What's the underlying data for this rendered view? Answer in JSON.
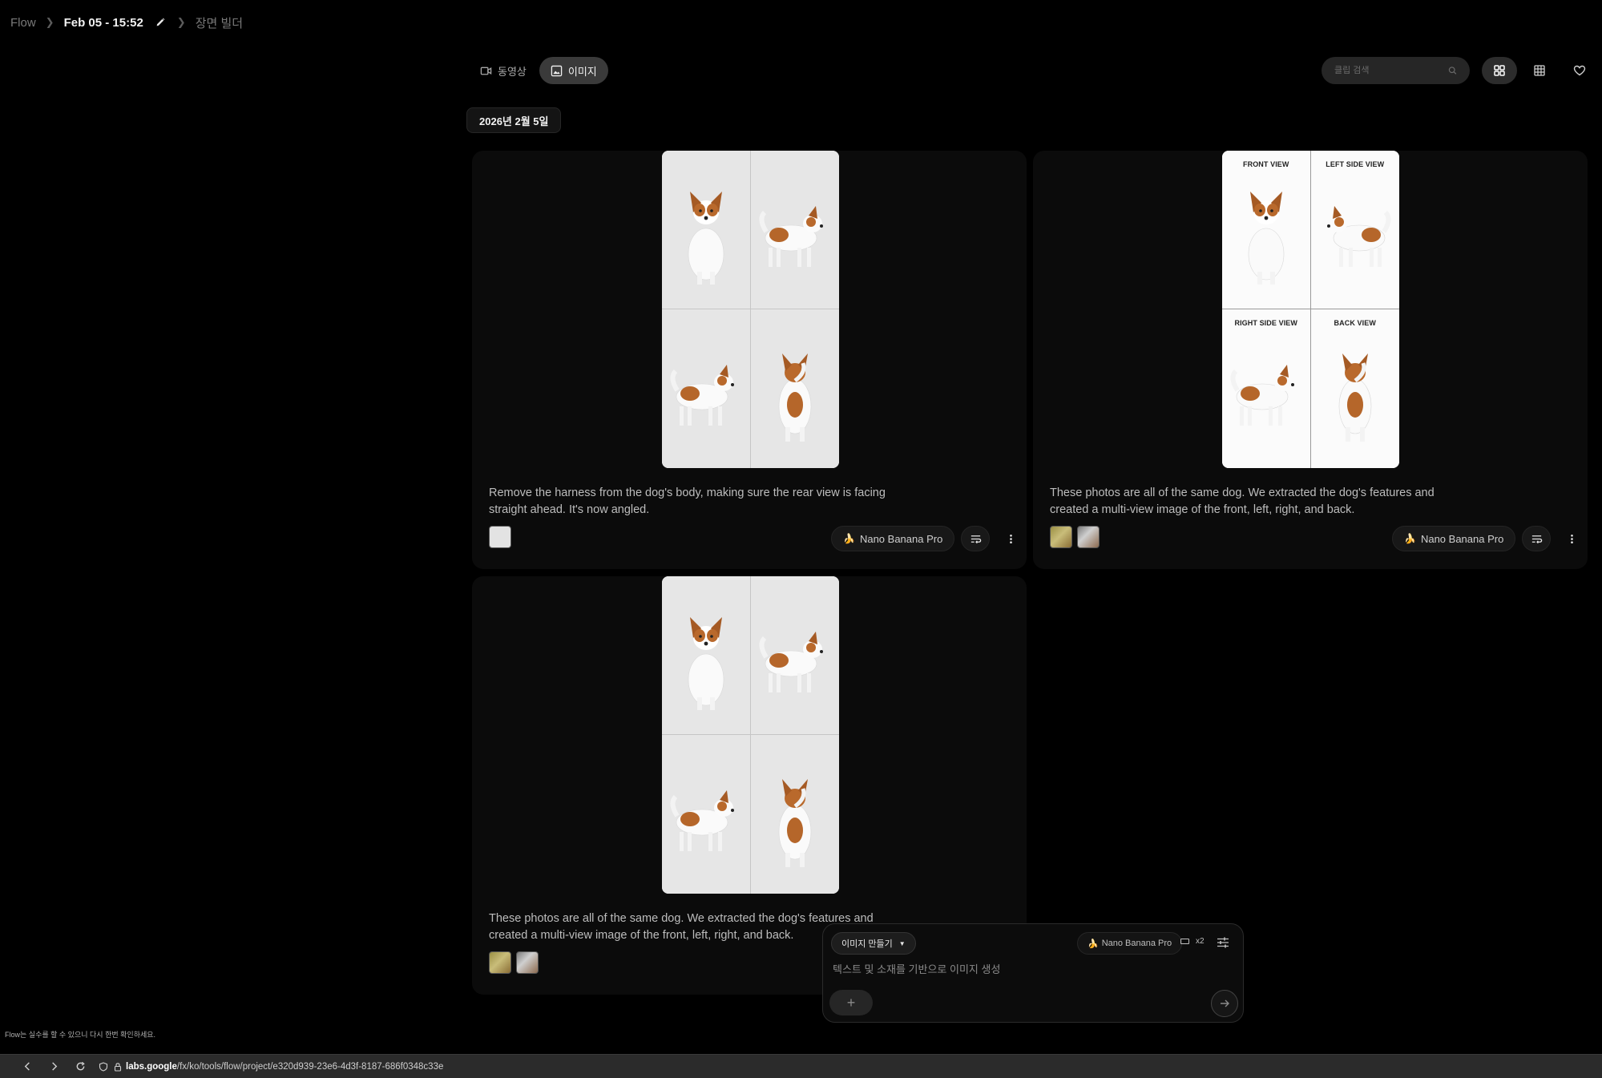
{
  "breadcrumb": {
    "root": "Flow",
    "project": "Feb 05 - 15:52",
    "section": "장면 빌더"
  },
  "mode_tabs": [
    {
      "label": "동영상",
      "icon": "video-icon",
      "active": false
    },
    {
      "label": "이미지",
      "icon": "image-icon",
      "active": true
    }
  ],
  "search": {
    "placeholder": "클립 검색",
    "icon": "search-icon"
  },
  "view_toggles": [
    {
      "icon": "grid-large-icon",
      "active": true
    },
    {
      "icon": "grid-small-icon",
      "active": false
    },
    {
      "icon": "heart-icon",
      "active": false
    }
  ],
  "date_chip": "2026년 2월 5일",
  "cards": [
    {
      "prompt": "Remove the harness from the dog's body, making sure the rear view is facing straight ahead. It's now angled.",
      "model": "Nano Banana Pro",
      "thumbs": [
        "reference-image-light"
      ],
      "view_labels": []
    },
    {
      "prompt": "These photos are all of the same dog. We extracted the dog's features and created a multi-view image of the front, left, right, and back.",
      "model": "Nano Banana Pro",
      "thumbs": [
        "reference-image-dog-1",
        "reference-image-dog-2"
      ],
      "view_labels": [
        "FRONT VIEW",
        "LEFT SIDE VIEW",
        "RIGHT SIDE VIEW",
        "BACK VIEW"
      ]
    },
    {
      "prompt": "These photos are all of the same dog. We extracted the dog's features and created a multi-view image of the front, left, right, and back.",
      "model": "Nano Banana Pro",
      "thumbs": [
        "reference-image-dog-1",
        "reference-image-dog-2"
      ],
      "view_labels": []
    }
  ],
  "composer": {
    "mode_label": "이미지 만들기",
    "model": "Nano Banana Pro",
    "count": "x2",
    "placeholder": "텍스트 및 소재를 기반으로 이미지 생성",
    "add_label": "+"
  },
  "disclaimer": "Flow는 실수를 할 수 있으니 다시 한번 확인하세요.",
  "browser": {
    "url_host": "labs.google",
    "url_path": "/fx/ko/tools/flow/project/e320d939-23e6-4d3f-8187-686f0348c33e"
  }
}
